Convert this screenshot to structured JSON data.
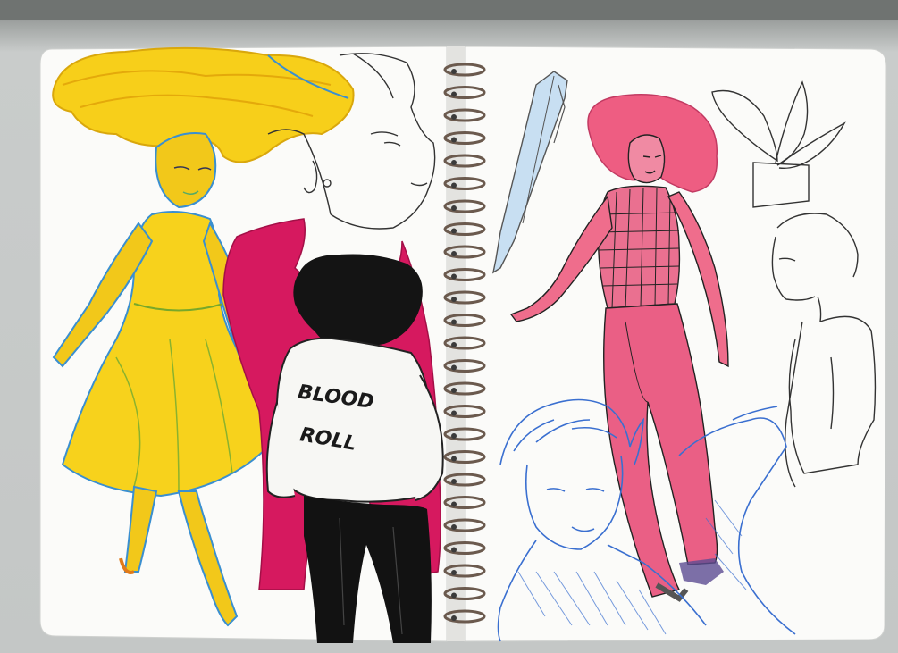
{
  "image": {
    "description_free": true
  },
  "jacket": {
    "line1": "BLOOD",
    "line2": "ROLL"
  },
  "colors": {
    "scan_background": "#b9bcbb",
    "paper": "#fbfbf9",
    "yellow_marker": "#f7cf1a",
    "magenta_marker": "#d6195f",
    "pink_marker": "#ea6a8a",
    "blue_pencil": "#3a6fd0",
    "ink": "#1d1d1d",
    "spiral": "#6b5a4e"
  }
}
